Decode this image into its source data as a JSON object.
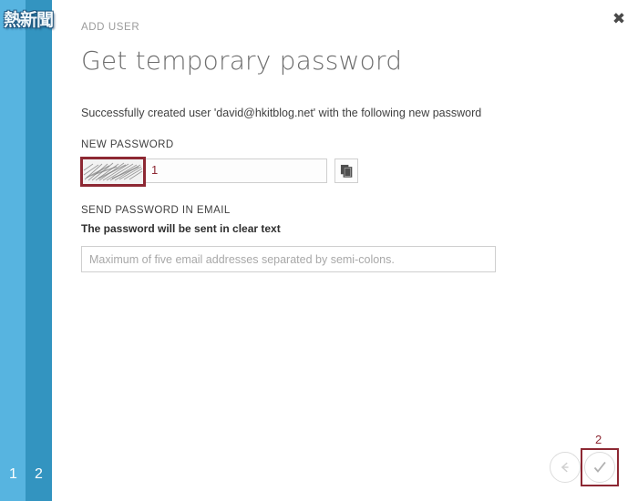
{
  "window": {
    "close_label": "✖"
  },
  "branding": {
    "logo_text": "熱新聞",
    "logo_name": "hkitblog-watermark-logo"
  },
  "sidebar": {
    "steps": [
      {
        "label": "1"
      },
      {
        "label": "2"
      }
    ],
    "colors": {
      "light": "#57b4e0",
      "dark": "#3394c0"
    }
  },
  "header": {
    "eyebrow": "ADD USER",
    "title": "Get temporary password"
  },
  "main": {
    "success_message": "Successfully created user 'david@hkitblog.net' with the following new password",
    "new_password": {
      "label": "NEW PASSWORD",
      "value": "",
      "redacted": true,
      "copy_icon": "copy-icon"
    },
    "send_email": {
      "label": "SEND PASSWORD IN EMAIL",
      "warning": "The password will be sent in clear text",
      "value": "",
      "placeholder": "Maximum of five email addresses separated by semi-colons."
    }
  },
  "actions": {
    "back_icon": "arrow-left-icon",
    "confirm_icon": "check-icon"
  },
  "annotations": {
    "marker_color": "#8d2833",
    "items": [
      {
        "number": "1",
        "target": "new-password-field"
      },
      {
        "number": "2",
        "target": "confirm-button"
      }
    ]
  }
}
